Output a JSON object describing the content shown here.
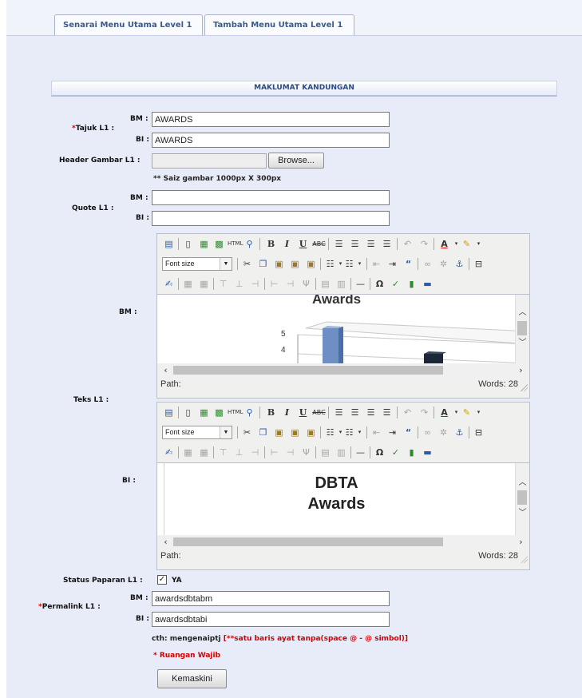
{
  "tabs": [
    {
      "label": "Senarai Menu Utama Level 1"
    },
    {
      "label": "Tambah Menu Utama Level 1"
    }
  ],
  "section": {
    "title": "MAKLUMAT KANDUNGAN"
  },
  "form": {
    "tajuk": {
      "label": "Tajuk L1 :",
      "required_mark": "*",
      "bm_label": "BM :",
      "bi_label": "BI :",
      "bm_value": "AWARDS",
      "bi_value": "AWARDS"
    },
    "header_gambar": {
      "label": "Header Gambar L1 :",
      "browse_label": "Browse...",
      "note": "** Saiz gambar 1000px X 300px"
    },
    "quote": {
      "label": "Quote L1 :",
      "bm_label": "BM :",
      "bi_label": "BI :",
      "bm_value": "",
      "bi_value": ""
    },
    "teks": {
      "label": "Teks L1 :",
      "bm_label": "BM :",
      "bi_label": "BI :"
    },
    "status": {
      "label": "Status Paparan L1 :",
      "checked": true,
      "option_label": "YA"
    },
    "permalink": {
      "label": "Permalink L1 :",
      "required_mark": "*",
      "bm_label": "BM :",
      "bi_label": "BI :",
      "bm_value": "awardsdbtabm",
      "bi_value": "awardsdbtabi"
    },
    "hint_prefix": "cth: mengenaiptj ",
    "hint_rule": "[**satu baris ayat tanpa(space @ - @ simbol)]",
    "required_note": "* Ruangan Wajib",
    "submit_label": "Kemaskini"
  },
  "editors": {
    "font_size_label": "Font size",
    "bm": {
      "path_label": "Path:",
      "words_label": "Words: 28",
      "chart": {
        "title": "Awards",
        "y_ticks": [
          "5",
          "4"
        ]
      }
    },
    "bi": {
      "path_label": "Path:",
      "words_label": "Words: 28",
      "heading_line1": "DBTA",
      "heading_line2": "Awards"
    }
  },
  "icons": {
    "toolbar_row1": [
      "source-icon",
      "new-document-icon",
      "paste-text-icon",
      "paste-word-icon",
      "html-icon",
      "preview-icon",
      "bold-icon",
      "italic-icon",
      "underline-icon",
      "strikethrough-icon",
      "align-left-icon",
      "align-center-icon",
      "align-right-icon",
      "align-justify-icon",
      "undo-icon",
      "redo-icon",
      "font-color-icon",
      "highlight-color-icon"
    ],
    "toolbar_row2": [
      "cut-icon",
      "copy-icon",
      "paste-icon",
      "paste-plain-icon",
      "paste-word-icon",
      "bullet-list-icon",
      "numbered-list-icon",
      "outdent-icon",
      "indent-icon",
      "blockquote-icon",
      "link-icon",
      "unlink-icon",
      "anchor-icon",
      "page-break-icon"
    ],
    "toolbar_row3": [
      "edit-icon",
      "table-icon",
      "table-props-icon",
      "row-above-icon",
      "row-below-icon",
      "delete-row-icon",
      "col-before-icon",
      "col-after-icon",
      "delete-col-icon",
      "merge-cells-icon",
      "split-cells-icon",
      "horizontal-rule-icon",
      "special-char-icon",
      "spellcheck-icon",
      "media-icon",
      "hr-icon"
    ]
  },
  "colors": {
    "page_bg": "#e8ecf9",
    "header_text": "#2a4a87",
    "required": "#d40000",
    "tab_text": "#3b5a8c"
  }
}
